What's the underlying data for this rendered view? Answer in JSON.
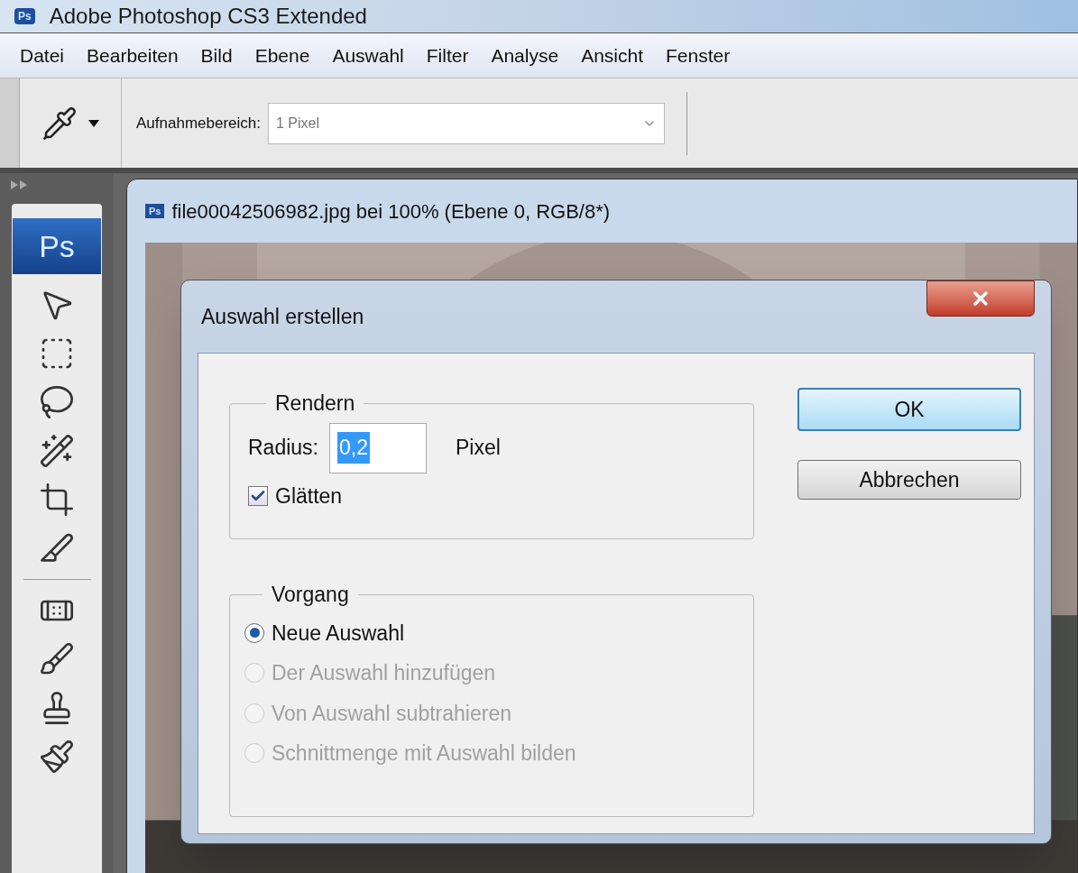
{
  "window": {
    "icon": "Ps",
    "title": "Adobe Photoshop CS3 Extended"
  },
  "menu": [
    "Datei",
    "Bearbeiten",
    "Bild",
    "Ebene",
    "Auswahl",
    "Filter",
    "Analyse",
    "Ansicht",
    "Fenster"
  ],
  "options_bar": {
    "label": "Aufnahmebereich:",
    "value": "1 Pixel"
  },
  "toolbox": {
    "logo": "Ps"
  },
  "document": {
    "icon": "Ps",
    "title": "file00042506982.jpg bei 100% (Ebene 0, RGB/8*)"
  },
  "dialog": {
    "title": "Auswahl erstellen",
    "render": {
      "legend": "Rendern",
      "radius_label": "Radius:",
      "radius_value": "0,2",
      "value_selected": true,
      "unit": "Pixel",
      "checkbox": {
        "label": "Glätten",
        "checked": true
      }
    },
    "operation": {
      "legend": "Vorgang",
      "options": [
        {
          "label": "Neue Auswahl",
          "selected": true,
          "disabled": false
        },
        {
          "label": "Der Auswahl hinzufügen",
          "selected": false,
          "disabled": true
        },
        {
          "label": "Von Auswahl subtrahieren",
          "selected": false,
          "disabled": true
        },
        {
          "label": "Schnittmenge mit Auswahl bilden",
          "selected": false,
          "disabled": true
        }
      ]
    },
    "buttons": [
      {
        "label": "OK",
        "default": true
      },
      {
        "label": "Abbrechen",
        "default": false
      }
    ]
  }
}
